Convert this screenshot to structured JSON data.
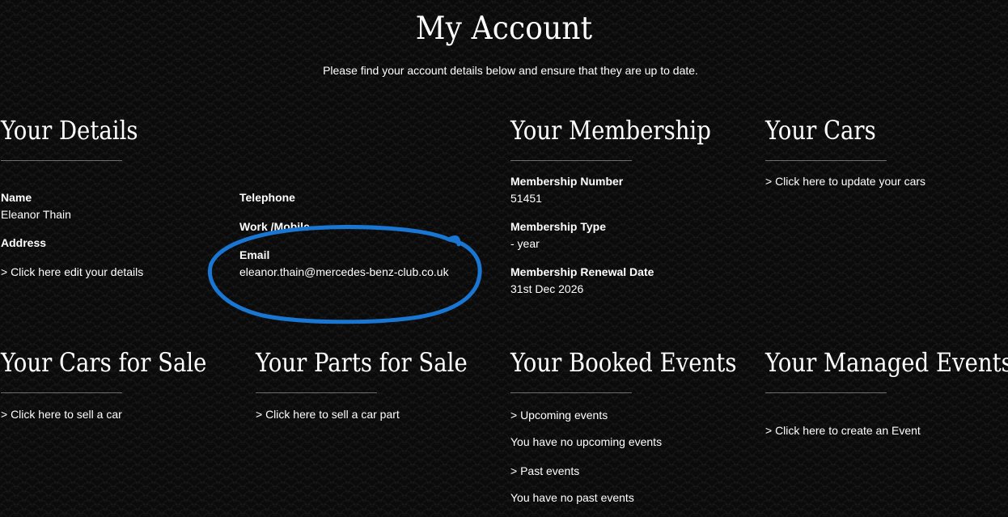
{
  "page": {
    "title": "My Account",
    "subtitle": "Please find your account details below and ensure that they are up to date."
  },
  "details": {
    "heading": "Your Details",
    "name_label": "Name",
    "name_value": "Eleanor Thain",
    "address_label": "Address",
    "edit_link": "> Click here edit your details",
    "telephone_label": "Telephone",
    "work_mobile_label": "Work /Mobile",
    "email_label": "Email",
    "email_value": "eleanor.thain@mercedes-benz-club.co.uk"
  },
  "membership": {
    "heading": "Your Membership",
    "number_label": "Membership Number",
    "number_value": "51451",
    "type_label": "Membership Type",
    "type_value": "- year",
    "renewal_label": "Membership Renewal Date",
    "renewal_value": "31st Dec 2026"
  },
  "cars": {
    "heading": "Your Cars",
    "link": "> Click here to update your cars"
  },
  "cars_for_sale": {
    "heading": "Your Cars for Sale",
    "link": "> Click here to sell a car"
  },
  "parts_for_sale": {
    "heading": "Your Parts for Sale",
    "link": "> Click here to sell a car part"
  },
  "booked_events": {
    "heading": "Your Booked Events",
    "upcoming_link": "> Upcoming events",
    "upcoming_text": "You have no upcoming events",
    "past_link": "> Past events",
    "past_text": "You have no past events"
  },
  "managed_events": {
    "heading": "Your Managed Events",
    "link": "> Click here to create an Event"
  },
  "colors": {
    "background": "#0b0b0b",
    "text": "#ffffff",
    "annotation": "#1976d2",
    "rule": "#6e6e6e"
  }
}
